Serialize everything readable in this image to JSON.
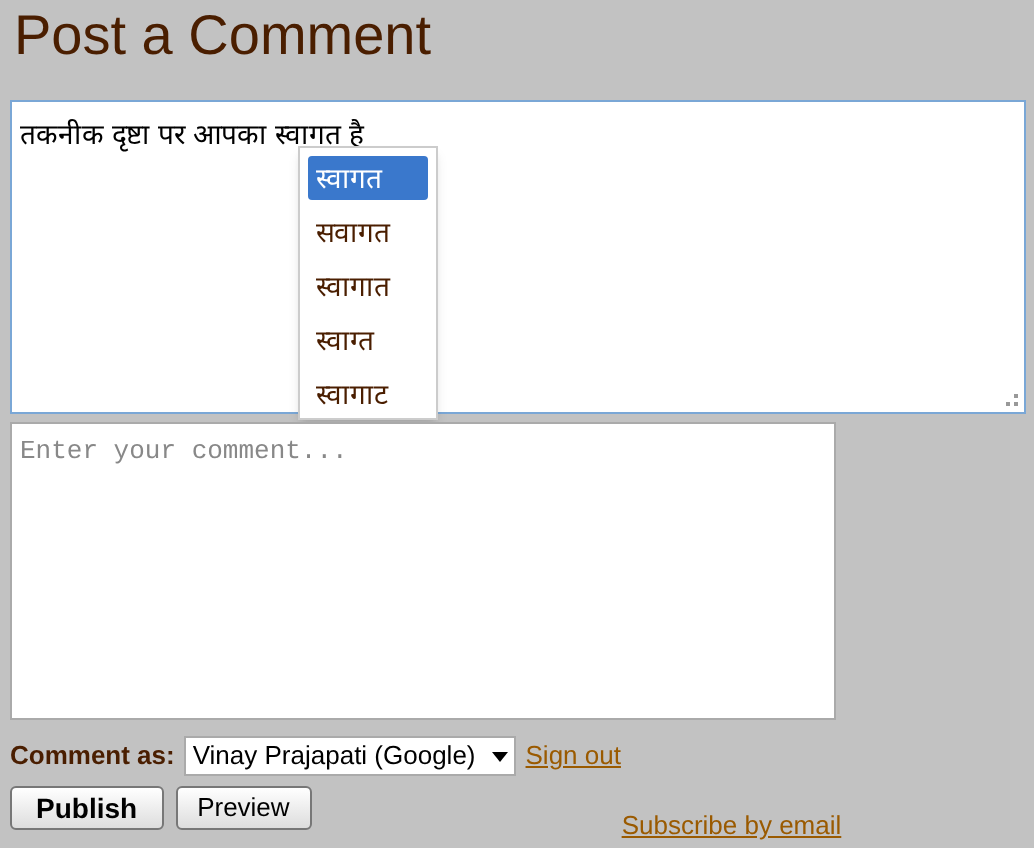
{
  "title": "Post a Comment",
  "editor": {
    "text": "तकनीक दृष्टा पर आपका स्वागत है",
    "suggestions": [
      {
        "label": "स्वागत",
        "selected": true
      },
      {
        "label": "सवागत",
        "selected": false
      },
      {
        "label": "स्वागात",
        "selected": false
      },
      {
        "label": "स्वाग्त",
        "selected": false
      },
      {
        "label": "स्वागाट",
        "selected": false
      }
    ]
  },
  "comment_box": {
    "placeholder": "Enter your comment..."
  },
  "comment_as": {
    "label": "Comment as:",
    "identity": "Vinay Prajapati (Google)",
    "sign_out": "Sign out"
  },
  "buttons": [
    {
      "label": "Publish",
      "kind": "primary"
    },
    {
      "label": "Preview",
      "kind": "secondary"
    }
  ],
  "subscribe_link": "Subscribe by email"
}
